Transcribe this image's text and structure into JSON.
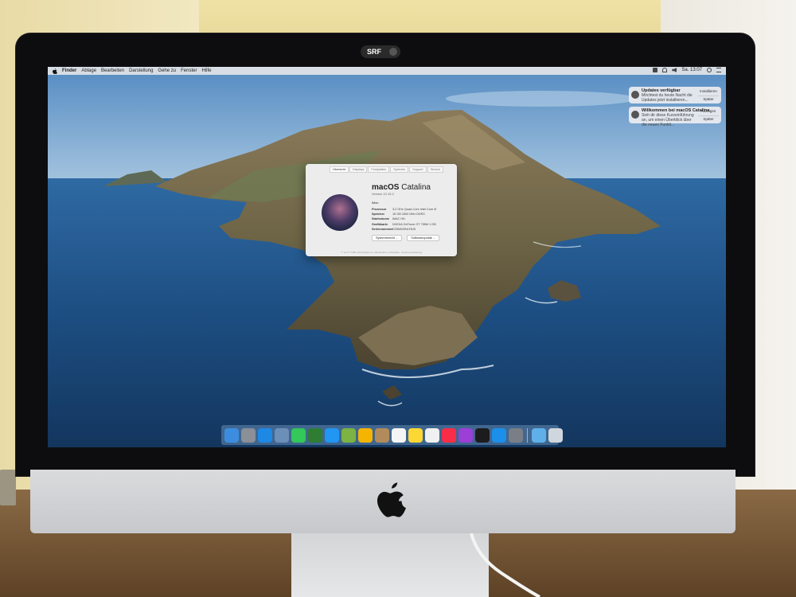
{
  "hardware": {
    "camera_cover_label": "SRF"
  },
  "menubar": {
    "items": [
      "Finder",
      "Ablage",
      "Bearbeiten",
      "Darstellung",
      "Gehe zu",
      "Fenster",
      "Hilfe"
    ],
    "clock": "Sa. 13:07"
  },
  "notifications": [
    {
      "title": "Updates verfügbar",
      "body": "Möchtest du heute Nacht die Updates jetzt installieren...",
      "action_primary": "Installieren",
      "action_secondary": "Später"
    },
    {
      "title": "Willkommen bei macOS Catalina",
      "body": "Sieh dir diese Kurzeinführung an, um einen Überblick über die neuen Funkti...",
      "action_primary": "Anzeigen",
      "action_secondary": "Später"
    }
  ],
  "about_window": {
    "tabs": [
      "Übersicht",
      "Displays",
      "Festplatten",
      "Speicher",
      "Support",
      "Service"
    ],
    "active_tab": "Übersicht",
    "os_name_bold": "macOS",
    "os_name_rest": " Catalina",
    "version": "Version 10.15.2",
    "model": "iMac",
    "specs": [
      {
        "label": "Prozessor",
        "value": "3,2 GHz Quad-Core Intel Core i5"
      },
      {
        "label": "Speicher",
        "value": "16 GB 1600 MHz DDR3"
      },
      {
        "label": "Startvolume",
        "value": "iMAC HD"
      },
      {
        "label": "Grafikkarte",
        "value": "NVIDIA GeForce GT 755M 1 GB"
      },
      {
        "label": "Seriennummer",
        "value": "D25MW5NLF8J5"
      }
    ],
    "buttons": [
      "Systembericht ...",
      "Softwareupdate ..."
    ],
    "footer": "™ und © 1983–2019 Apple Inc. Alle Rechte vorbehalten. Lizenzvereinbarung"
  },
  "dock": {
    "apps": [
      {
        "name": "Finder",
        "color": "#3c8de0"
      },
      {
        "name": "Launchpad",
        "color": "#8a8f98"
      },
      {
        "name": "Safari",
        "color": "#1e88e5"
      },
      {
        "name": "Fotos Vorschau",
        "color": "#6c8fb8"
      },
      {
        "name": "Nachrichten",
        "color": "#34c759"
      },
      {
        "name": "FaceTime",
        "color": "#2e7d32"
      },
      {
        "name": "Mail",
        "color": "#2196f3"
      },
      {
        "name": "Karten",
        "color": "#7cb342"
      },
      {
        "name": "Fotos",
        "color": "#f4b400"
      },
      {
        "name": "Kontakte",
        "color": "#b38b5a"
      },
      {
        "name": "Kalender",
        "color": "#f5f5f5"
      },
      {
        "name": "Notizen",
        "color": "#fdd835"
      },
      {
        "name": "Erinnerungen",
        "color": "#f0f0f0"
      },
      {
        "name": "Musik",
        "color": "#fa2d48"
      },
      {
        "name": "Podcasts",
        "color": "#9b3fd6"
      },
      {
        "name": "TV",
        "color": "#1c1c1e"
      },
      {
        "name": "App Store",
        "color": "#1b8fe9"
      },
      {
        "name": "Systemeinstellungen",
        "color": "#7a7f87"
      },
      {
        "name": "Downloads",
        "color": "#5fb0e8"
      },
      {
        "name": "Papierkorb",
        "color": "#cfd6dd"
      }
    ]
  }
}
